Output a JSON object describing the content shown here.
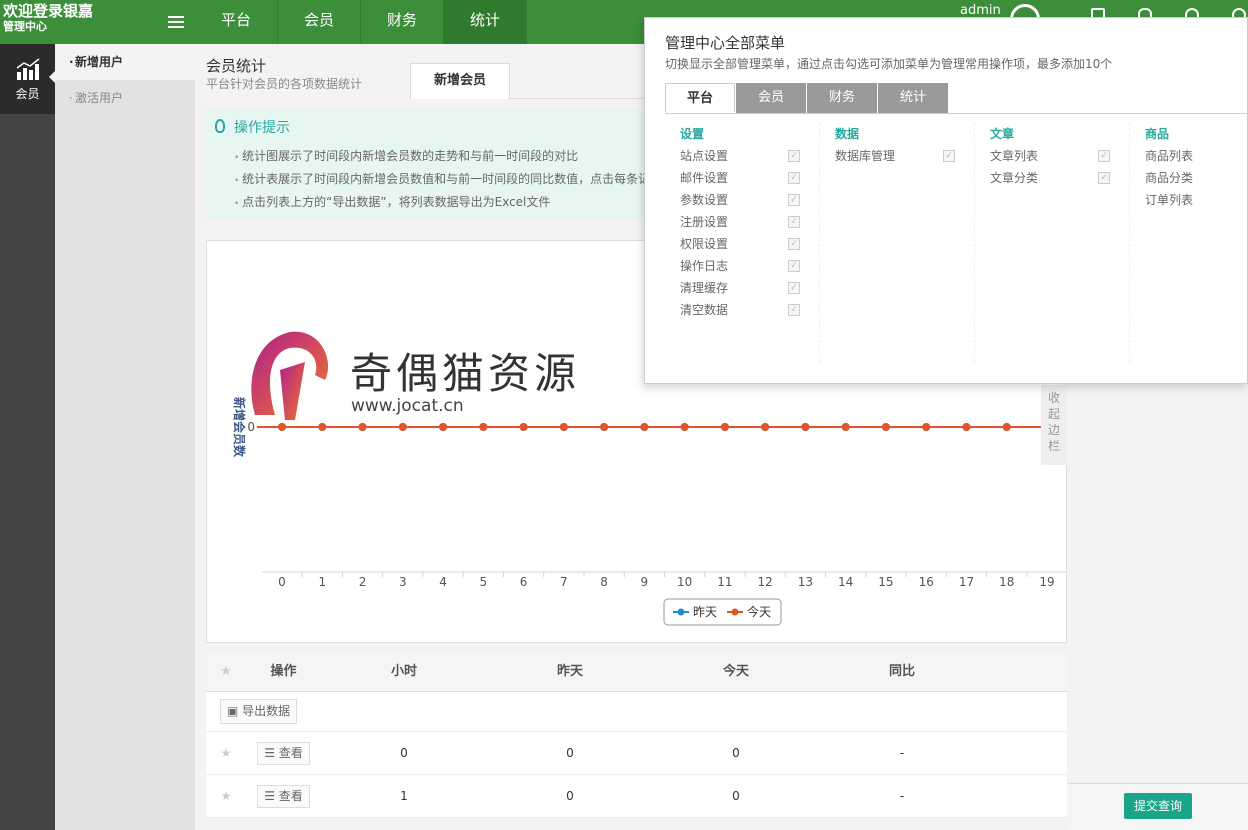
{
  "brand": {
    "title": "欢迎登录银嘉",
    "subtitle": "管理中心"
  },
  "topnav": [
    "平台",
    "会员",
    "财务",
    "统计"
  ],
  "user": {
    "name": "admin"
  },
  "leftbar": {
    "module_label": "会员"
  },
  "submenu": [
    "新增用户",
    "激活用户"
  ],
  "main": {
    "title": "会员统计",
    "subtitle": "平台针对会员的各项数据统计",
    "tab": "新增会员"
  },
  "tips": {
    "title": "操作提示",
    "items": [
      "统计图展示了时间段内新增会员数的走势和与前一时间段的对比",
      "统计表展示了时间段内新增会员数值和与前一时间段的同比数值，点击每条记",
      "点击列表上方的“导出数据”，将列表数据导出为Excel文件"
    ]
  },
  "chart_data": {
    "type": "line",
    "x": [
      0,
      1,
      2,
      3,
      4,
      5,
      6,
      7,
      8,
      9,
      10,
      11,
      12,
      13,
      14,
      15,
      16,
      17,
      18,
      19
    ],
    "series": [
      {
        "name": "昨天",
        "color": "#1f8dd6",
        "values": [
          0,
          0,
          0,
          0,
          0,
          0,
          0,
          0,
          0,
          0,
          0,
          0,
          0,
          0,
          0,
          0,
          0,
          0,
          0,
          0
        ]
      },
      {
        "name": "今天",
        "color": "#e2542a",
        "values": [
          0,
          0,
          0,
          0,
          0,
          0,
          0,
          0,
          0,
          0,
          0,
          0,
          0,
          0,
          0,
          0,
          0,
          0,
          0,
          0
        ]
      }
    ],
    "ylabel": "新增会员数",
    "yticks": [
      "0"
    ],
    "legend": "bottom-center"
  },
  "sidebar_toggle": "收起边栏",
  "watermark": {
    "name": "奇偶猫资源",
    "url": "www.jocat.cn"
  },
  "table": {
    "headers": [
      "操作",
      "小时",
      "昨天",
      "今天",
      "同比"
    ],
    "export_label": "导出数据",
    "view_label": "查看",
    "rows": [
      [
        "0",
        "0",
        "0",
        "-"
      ],
      [
        "1",
        "0",
        "0",
        "-"
      ]
    ]
  },
  "submit_label": "提交查询",
  "panel": {
    "title": "管理中心全部菜单",
    "desc": "切换显示全部管理菜单，通过点击勾选可添加菜单为管理常用操作项，最多添加10个",
    "tabs": [
      "平台",
      "会员",
      "财务",
      "统计"
    ],
    "groups": [
      {
        "title": "设置",
        "items": [
          "站点设置",
          "邮件设置",
          "参数设置",
          "注册设置",
          "权限设置",
          "操作日志",
          "清理缓存",
          "清空数据"
        ],
        "checkable": true
      },
      {
        "title": "数据",
        "items": [
          "数据库管理"
        ],
        "checkable": true
      },
      {
        "title": "文章",
        "items": [
          "文章列表",
          "文章分类"
        ],
        "checkable": true
      },
      {
        "title": "商品",
        "items": [
          "商品列表",
          "商品分类",
          "订单列表"
        ],
        "checkable": false
      }
    ]
  },
  "colors": {
    "topbar": "#3c8e3a",
    "accent": "#27a9a0",
    "submit": "#1aa58a"
  }
}
